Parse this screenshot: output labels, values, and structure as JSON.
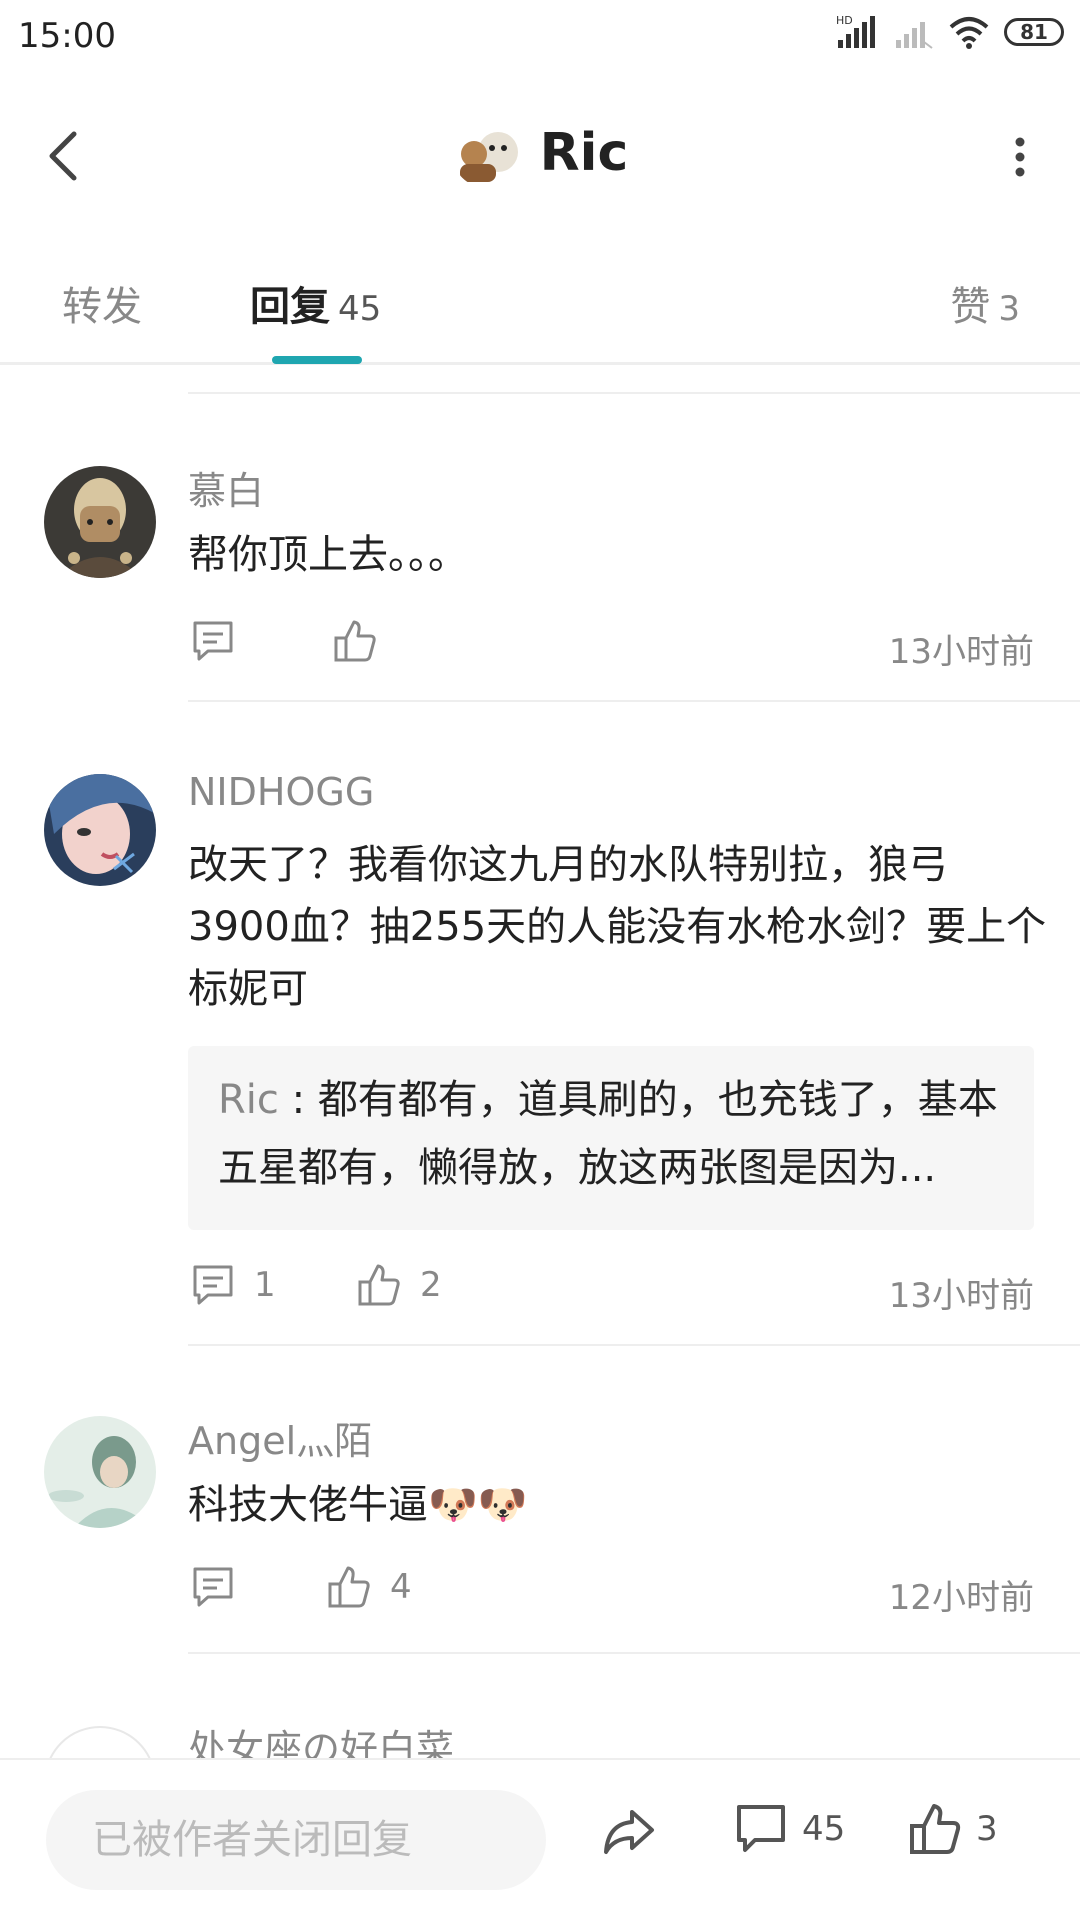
{
  "status": {
    "time": "15:00",
    "network": "HD",
    "battery": "81"
  },
  "header": {
    "title": "Ric"
  },
  "tabs": {
    "repost_label": "转发",
    "reply_label": "回复",
    "reply_count": "45",
    "like_label": "赞",
    "like_count": "3"
  },
  "comments": [
    {
      "name": "慕白",
      "text": "帮你顶上去。。。",
      "reply_count": "",
      "like_count": "",
      "time": "13小时前"
    },
    {
      "name": "NIDHOGG",
      "text": "改天了？我看你这九月的水队特别拉，狼弓3900血？抽255天的人能没有水枪水剑？要上个标妮可",
      "quote_author": "Ric",
      "quote_sep": " : ",
      "quote_text": "都有都有，道具刷的，也充钱了，基本五星都有，懒得放，放这两张图是因为...",
      "reply_count": "1",
      "like_count": "2",
      "time": "13小时前"
    },
    {
      "name": "Angel灬陌",
      "text": "科技大佬牛逼🐶🐶",
      "reply_count": "",
      "like_count": "4",
      "time": "12小时前"
    },
    {
      "name": "处女座の好白菜"
    }
  ],
  "bottom": {
    "input_placeholder": "已被作者关闭回复",
    "comment_count": "45",
    "like_count": "3"
  },
  "colors": {
    "accent": "#1fa6b0",
    "muted": "#888888"
  }
}
